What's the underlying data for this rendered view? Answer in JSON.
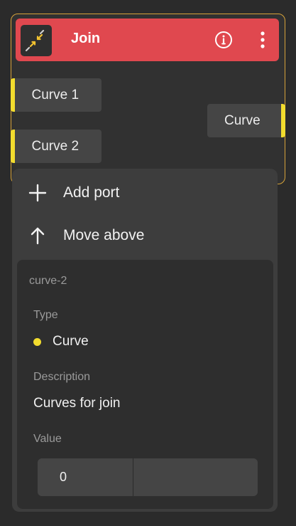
{
  "node": {
    "title": "Join",
    "icon": "join-arrows-icon",
    "header_color": "#e0484f",
    "border_color": "#d6a33a",
    "port_color": "#f2dc2e",
    "inputs": [
      {
        "label": "Curve 1"
      },
      {
        "label": "Curve 2"
      }
    ],
    "outputs": [
      {
        "label": "Curve"
      }
    ]
  },
  "menu": {
    "items": [
      {
        "label": "Add port",
        "icon": "plus-icon"
      },
      {
        "label": "Move above",
        "icon": "arrow-up-icon"
      }
    ]
  },
  "port_details": {
    "id": "curve-2",
    "type_label": "Type",
    "type_value": "Curve",
    "description_label": "Description",
    "description_value": "Curves for join",
    "value_label": "Value",
    "value": "0"
  }
}
